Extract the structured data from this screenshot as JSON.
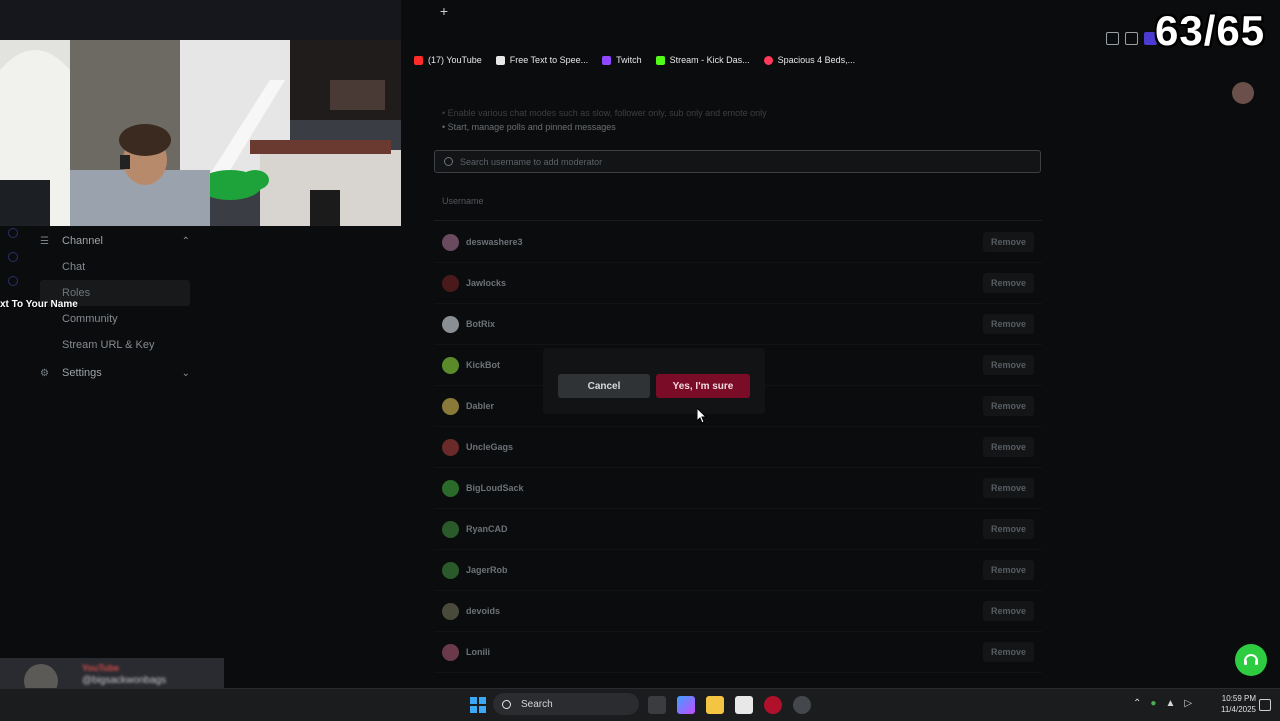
{
  "browser": {
    "new_tab": "+",
    "bookmarks": [
      {
        "label": "(17) YouTube",
        "icon": "youtube-icon",
        "color": "#ff2a2a"
      },
      {
        "label": "Free Text to Spee...",
        "icon": "document-icon",
        "color": "#e8e8e8"
      },
      {
        "label": "Twitch",
        "icon": "twitch-icon",
        "color": "#9146ff"
      },
      {
        "label": "Stream - Kick Das...",
        "icon": "kick-icon",
        "color": "#53fc18"
      },
      {
        "label": "Spacious 4 Beds,...",
        "icon": "airbnb-icon",
        "color": "#ff385c"
      }
    ]
  },
  "overlay": {
    "counter": "63/65",
    "name_text": "xt To Your Name"
  },
  "sidebar": {
    "group_label": "Channel",
    "items": [
      "Chat",
      "Roles",
      "Community",
      "Stream URL & Key"
    ],
    "active_item": "Roles",
    "settings_label": "Settings"
  },
  "main": {
    "description": [
      "Enable various chat modes such as slow, follower only, sub only and emote only",
      "Start, manage polls and pinned messages"
    ],
    "search_placeholder": "Search username to add moderator",
    "column_header": "Username",
    "remove_label": "Remove",
    "moderators": [
      {
        "name": "deswashere3",
        "color": "#6a4a5e"
      },
      {
        "name": "Jawlocks",
        "color": "#4a1a1a"
      },
      {
        "name": "BotRix",
        "color": "#8a8f94"
      },
      {
        "name": "KickBot",
        "color": "#5a8a2a"
      },
      {
        "name": "Dabler",
        "color": "#8a7a3a"
      },
      {
        "name": "UncleGags",
        "color": "#6a2a2a"
      },
      {
        "name": "BigLoudSack",
        "color": "#2a6a2a"
      },
      {
        "name": "RyanCAD",
        "color": "#2a5a2a"
      },
      {
        "name": "JagerRob",
        "color": "#2a5a2a"
      },
      {
        "name": "devoids",
        "color": "#4a4a3a"
      },
      {
        "name": "Lonili",
        "color": "#6a3a4a"
      }
    ]
  },
  "dialog": {
    "cancel_label": "Cancel",
    "confirm_label": "Yes, I'm sure"
  },
  "chat_overlay": {
    "line1": "YouTube",
    "line2": "@bigsackwonbags"
  },
  "taskbar": {
    "search_label": "Search",
    "time": "10:59 PM",
    "date": "11/4/2025"
  },
  "colors": {
    "accent_danger": "#7b0c28",
    "support": "#2ecc40"
  }
}
